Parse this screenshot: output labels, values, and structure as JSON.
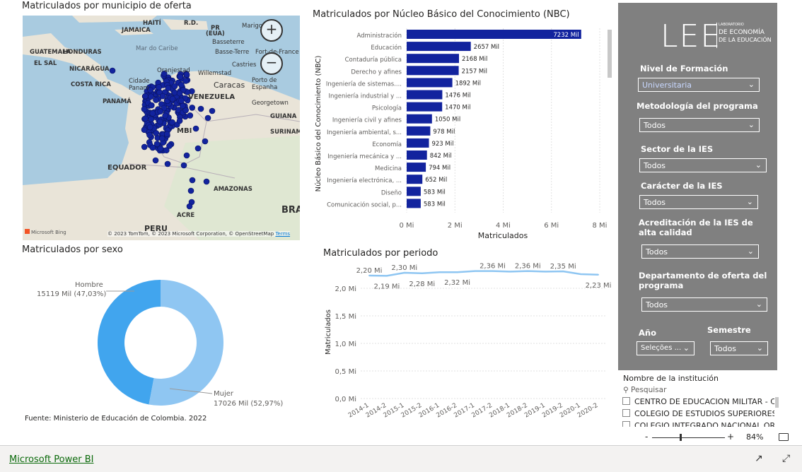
{
  "map": {
    "title": "Matriculados por municipio de oferta",
    "zoom_in": "+",
    "zoom_out": "−",
    "labels": {
      "haiti": "HAITÍ",
      "rd": "R.D.",
      "pr": "PR",
      "eua": "(EUA)",
      "jamaica": "JAMAICA",
      "mar_caribe": "Mar do Caribe",
      "guatemala": "GUATEMALA",
      "honduras": "HONDURAS",
      "el_salvador": "EL SAL",
      "nicaragua": "NICARÁGUA",
      "costa_rica": "COSTA RICA",
      "panama": "PANAMÁ",
      "oranjestad": "Oranjestad",
      "willemstad": "Willemstad",
      "caracas": "Caracas",
      "venezuela": "VENEZUELA",
      "porto_espanha": "Porto de\nEspanha",
      "georgetown": "Georgetown",
      "guiana": "GUIANA",
      "surinam": "SURINAM",
      "equador": "EQUADOR",
      "amazonas": "AMAZONAS",
      "acre": "ACRE",
      "peru": "PERU",
      "bra": "BRA",
      "basseterre": "Basseterre",
      "basse_terre": "Basse-Terre",
      "fort_de_france": "Fort-de-France",
      "castries": "Castries",
      "marigot": "Marigo",
      "cidade_panama": "Cidade\nPanam",
      "mbi": "MBI"
    },
    "copyright": "© 2023 TomTom, © 2023 Microsoft Corporation, © OpenStreetMap",
    "terms": "Terms",
    "bing": "Microsoft Bing"
  },
  "nbc": {
    "title": "Matriculados por Núcleo Básico del Conocimiento (NBC)",
    "ylabel": "Núcleo Básico del Conocimiento (NBC)",
    "xlabel": "Matriculados"
  },
  "chart_data": [
    {
      "type": "bar",
      "orientation": "horizontal",
      "title": "Matriculados por Núcleo Básico del Conocimiento (NBC)",
      "xlabel": "Matriculados",
      "ylabel": "Núcleo Básico del Conocimiento (NBC)",
      "categories": [
        "Administración",
        "Educación",
        "Contaduría pública",
        "Derecho y afines",
        "Ingeniería de sistemas....",
        "Ingeniería industrial y ...",
        "Psicología",
        "Ingeniería civil y afines",
        "Ingeniería ambiental, s...",
        "Economía",
        "Ingeniería mecánica y ...",
        "Medicina",
        "Ingeniería electrónica, ...",
        "Diseño",
        "Comunicación social, p..."
      ],
      "values": [
        7232,
        2657,
        2168,
        2157,
        1892,
        1476,
        1470,
        1050,
        978,
        923,
        842,
        794,
        652,
        583,
        583
      ],
      "value_labels": [
        "7232 Mil",
        "2657 Mil",
        "2168 Mil",
        "2157 Mil",
        "1892 Mil",
        "1476 Mil",
        "1470 Mil",
        "1050 Mil",
        "978 Mil",
        "923 Mil",
        "842 Mil",
        "794 Mil",
        "652 Mil",
        "583 Mil",
        "583 Mil"
      ],
      "xticks": [
        "0 Mi",
        "2 Mi",
        "4 Mi",
        "6 Mi",
        "8 Mi"
      ],
      "xlim": [
        0,
        8000
      ],
      "color": "#12239e"
    },
    {
      "type": "line",
      "title": "Matriculados por periodo",
      "ylabel": "Matriculados",
      "categories": [
        "2014-1",
        "2014-2",
        "2015-1",
        "2015-2",
        "2016-1",
        "2016-2",
        "2017-1",
        "2017-2",
        "2018-1",
        "2018-2",
        "2019-1",
        "2019-2",
        "2020-1",
        "2020-2"
      ],
      "values": [
        2.2,
        2.19,
        2.3,
        2.28,
        2.32,
        2.32,
        2.36,
        2.36,
        2.34,
        2.36,
        2.34,
        2.35,
        2.25,
        2.23
      ],
      "value_labels": [
        "2,20 Mi",
        "2,19 Mi",
        "2,30 Mi",
        "2,28 Mi",
        "",
        "2,32 Mi",
        "",
        "2,36 Mi",
        "",
        "2,36 Mi",
        "",
        "2,35 Mi",
        "",
        "2,23 Mi"
      ],
      "yticks": [
        "0,0 Mi",
        "0,5 Mi",
        "1,0 Mi",
        "1,5 Mi",
        "2,0 Mi"
      ],
      "ylim": [
        0,
        2.5
      ],
      "color": "#8fc6f2"
    },
    {
      "type": "pie",
      "title": "Matriculados por sexo",
      "donut": true,
      "slices": [
        {
          "name": "Hombre",
          "value": 15119,
          "label": "15119 Mil (47,03%)",
          "color": "#41a5ee"
        },
        {
          "name": "Mujer",
          "value": 17026,
          "label": "17026 Mil (52,97%)",
          "color": "#8fc6f2"
        }
      ]
    }
  ],
  "period": {
    "title": "Matriculados por periodo",
    "ylabel": "Matriculados"
  },
  "sex": {
    "title": "Matriculados por sexo",
    "hombre_name": "Hombre",
    "hombre_label": "15119 Mil (47,03%)",
    "mujer_name": "Mujer",
    "mujer_label": "17026 Mil (52,97%)",
    "source": "Fuente: Ministerio de Educación de Colombia. 2022"
  },
  "panel": {
    "logo": "LEE",
    "logo_sub1": "LABORATORIO",
    "logo_sub2": "DE ECONOMÍA",
    "logo_sub3": "DE LA EDUCACIÓN",
    "nivel_label": "Nivel de Formación",
    "nivel_value": "Universitaria",
    "metodo_label": "Metodología del programa",
    "metodo_value": "Todos",
    "sector_label": "Sector de la IES",
    "sector_value": "Todos",
    "caracter_label": "Carácter de la IES",
    "caracter_value": "Todos",
    "acred_label1": "Acreditación de la IES de",
    "acred_label2": "alta calidad",
    "acred_value": "Todos",
    "depto_label1": "Departamento de oferta del",
    "depto_label2": "programa",
    "depto_value": "Todos",
    "ano_label": "Año",
    "ano_value": "Seleções ...",
    "semestre_label": "Semestre",
    "semestre_value": "Todos"
  },
  "institution": {
    "title": "Nombre de la institución",
    "search_placeholder": "Pesquisar",
    "items": [
      "CENTRO DE EDUCACION MILITAR - CE...",
      "COLEGIO DE ESTUDIOS SUPERIORES D...",
      "COLEGIO INTEGRADO NACIONAL ORIE..."
    ]
  },
  "zoom": {
    "minus": "-",
    "plus": "+",
    "percent": "84%"
  },
  "footer": {
    "brand": "Microsoft Power BI"
  }
}
